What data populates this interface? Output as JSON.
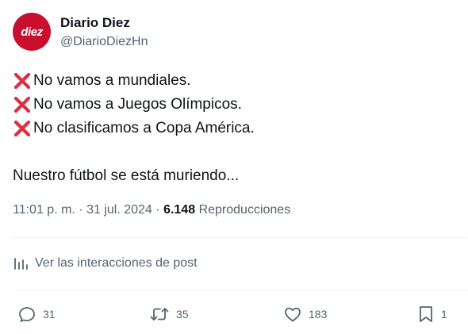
{
  "author": {
    "display_name": "Diario Diez",
    "handle": "@DiarioDiezHn",
    "avatar_logo_text": "diez",
    "avatar_color": "#c8102e"
  },
  "tweet": {
    "lines": [
      "No vamos a mundiales.",
      "No vamos a Juegos Olímpicos.",
      "No clasificamos a Copa América."
    ],
    "closing": "Nuestro fútbol se está muriendo...",
    "bullet_icon": "cross-mark-emoji"
  },
  "meta": {
    "time": "11:01 p. m.",
    "separator": "·",
    "date": "31 jul. 2024",
    "views_count": "6.148",
    "views_label": "Reproducciones"
  },
  "interactions_link": "Ver las interacciones de post",
  "actions": {
    "replies": "31",
    "reposts": "35",
    "likes": "183",
    "bookmarks": "1"
  },
  "colors": {
    "text_primary": "#0f1419",
    "text_secondary": "#536471",
    "cross_red": "#dd2e44",
    "divider": "#eff3f4"
  }
}
